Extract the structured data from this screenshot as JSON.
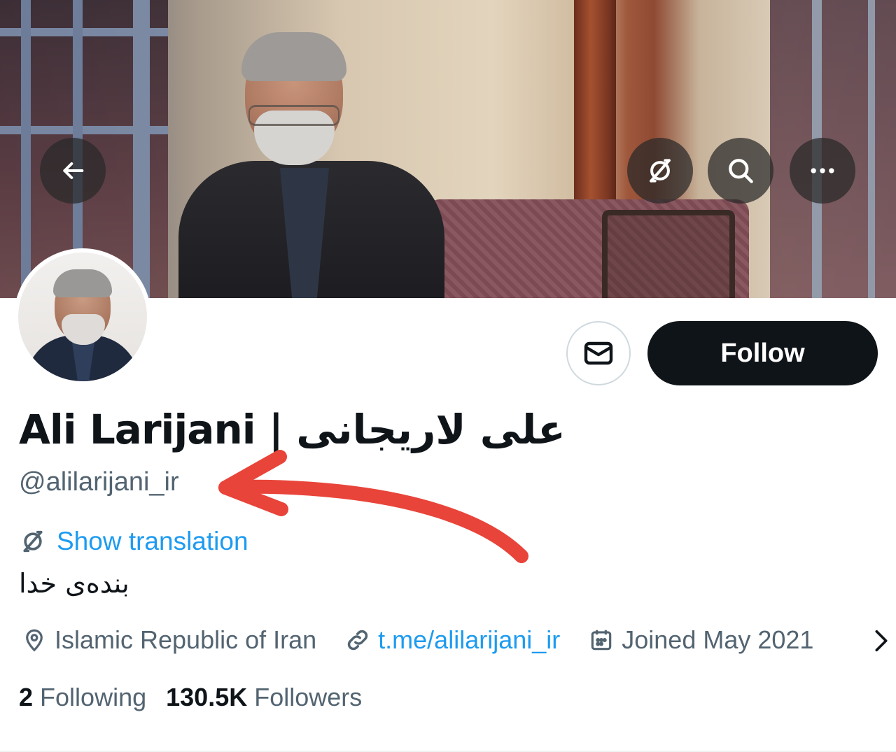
{
  "header": {
    "back_icon": "arrow-left-icon",
    "translate_icon": "translate-icon",
    "search_icon": "search-icon",
    "more_icon": "more-horizontal-icon"
  },
  "actions": {
    "message_icon": "envelope-icon",
    "follow_label": "Follow"
  },
  "profile": {
    "display_name": "Ali Larijani | علی لاریجانی",
    "handle": "@alilarijani_ir",
    "show_translation": "Show translation",
    "bio": "بنده‌ی خدا",
    "location": "Islamic Republic of Iran",
    "website": "t.me/alilarijani_ir",
    "joined": "Joined May 2021"
  },
  "stats": {
    "following_count": "2",
    "following_label": "Following",
    "followers_count": "130.5K",
    "followers_label": "Followers"
  },
  "colors": {
    "accent": "#1d9bf0",
    "secondary_text": "#536471",
    "primary_text": "#0f1419",
    "annotation_arrow": "#e8443a"
  }
}
